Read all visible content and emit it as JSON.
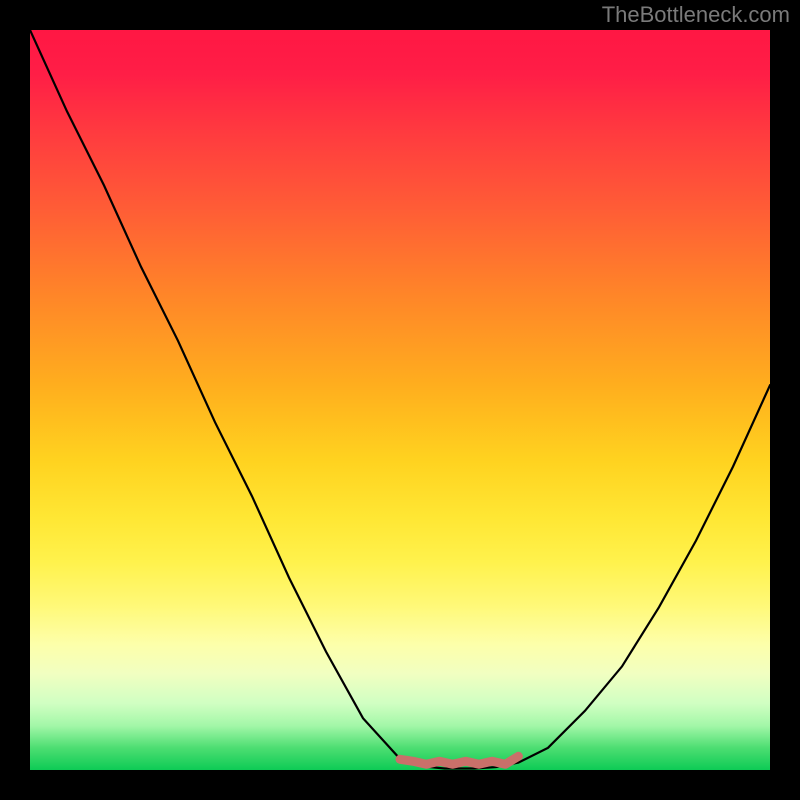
{
  "watermark": "TheBottleneck.com",
  "chart_data": {
    "type": "line",
    "title": "",
    "xlabel": "",
    "ylabel": "",
    "x": [
      0.0,
      0.05,
      0.1,
      0.15,
      0.2,
      0.25,
      0.3,
      0.35,
      0.4,
      0.45,
      0.5,
      0.53,
      0.56,
      0.58,
      0.6,
      0.63,
      0.66,
      0.7,
      0.75,
      0.8,
      0.85,
      0.9,
      0.95,
      1.0
    ],
    "series": [
      {
        "name": "bottleneck-curve",
        "values": [
          1.0,
          0.89,
          0.79,
          0.68,
          0.58,
          0.47,
          0.37,
          0.26,
          0.16,
          0.07,
          0.015,
          0.005,
          0.002,
          0.002,
          0.002,
          0.004,
          0.01,
          0.03,
          0.08,
          0.14,
          0.22,
          0.31,
          0.41,
          0.52
        ]
      }
    ],
    "annotations": [
      {
        "name": "trough-marker",
        "type": "bumpy-segment",
        "color": "#c9706a",
        "x_start": 0.5,
        "x_end": 0.66,
        "y": 0.005
      }
    ],
    "xlim": [
      0,
      1
    ],
    "ylim": [
      0,
      1
    ],
    "background": {
      "type": "vertical-gradient",
      "stops": [
        {
          "pos": 0.0,
          "color": "#ff1744"
        },
        {
          "pos": 0.5,
          "color": "#ffd21f"
        },
        {
          "pos": 0.82,
          "color": "#fdffaa"
        },
        {
          "pos": 1.0,
          "color": "#0dcb55"
        }
      ]
    },
    "frame_color": "#000000"
  }
}
